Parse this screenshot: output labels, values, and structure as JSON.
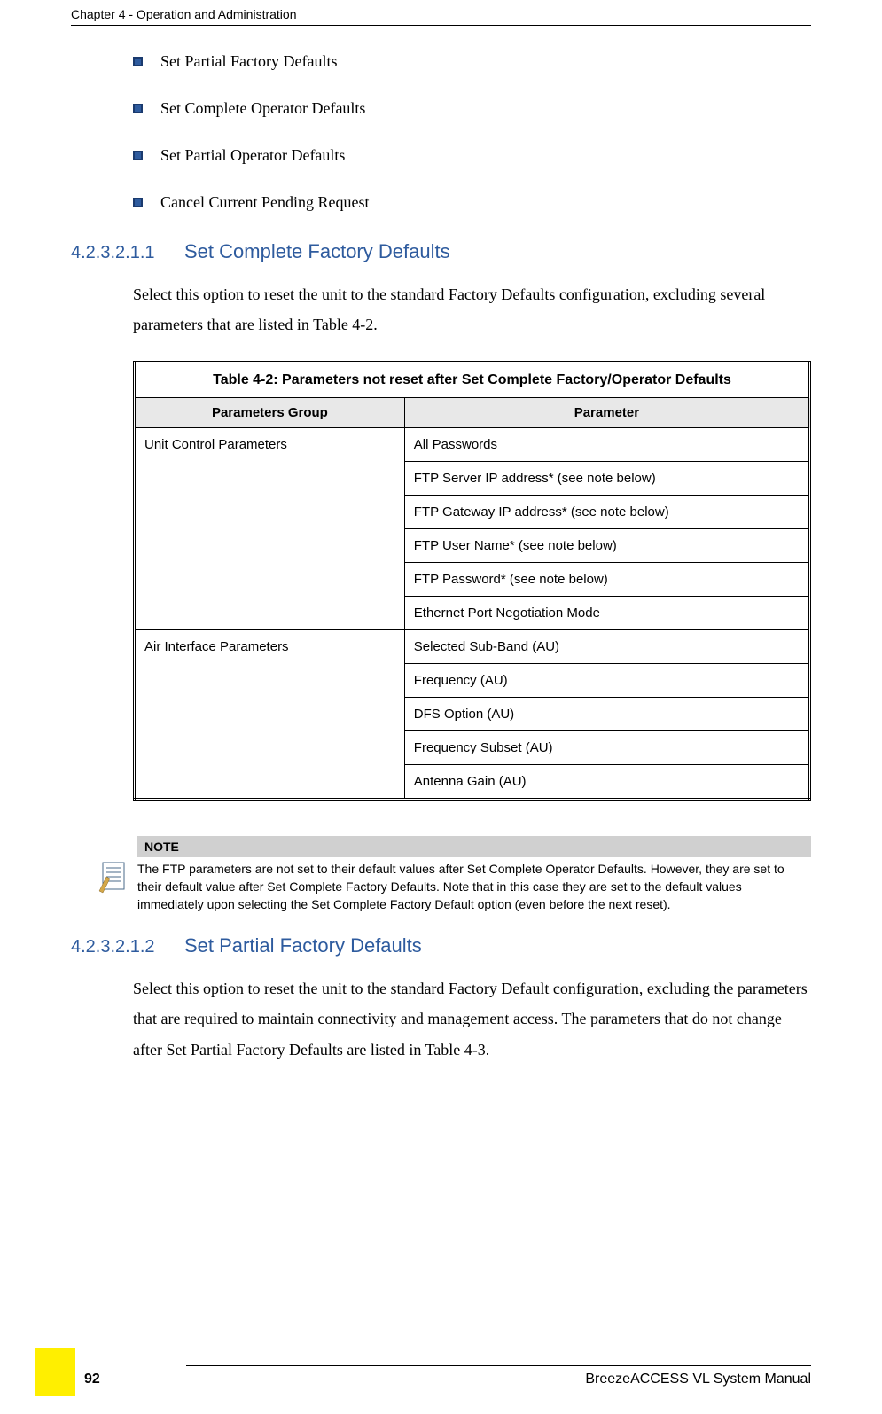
{
  "header": {
    "chapter": "Chapter 4 - Operation and Administration"
  },
  "bullets": [
    "Set Partial Factory Defaults",
    "Set Complete Operator Defaults",
    "Set Partial Operator Defaults",
    "Cancel Current Pending Request"
  ],
  "section1": {
    "num": "4.2.3.2.1.1",
    "title": "Set Complete Factory Defaults",
    "body": "Select this option to reset the unit to the standard Factory Defaults configuration, excluding several parameters that are listed in Table 4-2."
  },
  "table": {
    "title": "Table 4-2: Parameters not reset after Set Complete Factory/Operator Defaults",
    "col1": "Parameters Group",
    "col2": "Parameter",
    "group1": "Unit Control Parameters",
    "g1p1": "All Passwords",
    "g1p2": "FTP Server IP address* (see note below)",
    "g1p3": "FTP Gateway IP address* (see note below)",
    "g1p4": "FTP User Name* (see note below)",
    "g1p5": "FTP Password* (see note below)",
    "g1p6": "Ethernet Port Negotiation Mode",
    "group2": "Air Interface Parameters",
    "g2p1": "Selected Sub-Band (AU)",
    "g2p2": "Frequency (AU)",
    "g2p3": "DFS Option (AU)",
    "g2p4": "Frequency Subset (AU)",
    "g2p5": "Antenna Gain (AU)"
  },
  "note": {
    "header": "NOTE",
    "text": "The FTP parameters are not set to their default values after Set Complete Operator Defaults. However, they are set to their default value after Set Complete Factory Defaults. Note that in this case they are set to the default values immediately upon selecting the Set Complete Factory Default option (even before the next reset)."
  },
  "section2": {
    "num": "4.2.3.2.1.2",
    "title": "Set Partial Factory Defaults",
    "body": "Select this option to reset the unit to the standard Factory Default configuration, excluding the parameters that are required to maintain connectivity and management access. The parameters that do not change after Set Partial Factory Defaults are listed in Table 4-3."
  },
  "footer": {
    "manual": "BreezeACCESS VL System Manual",
    "page": "92"
  }
}
